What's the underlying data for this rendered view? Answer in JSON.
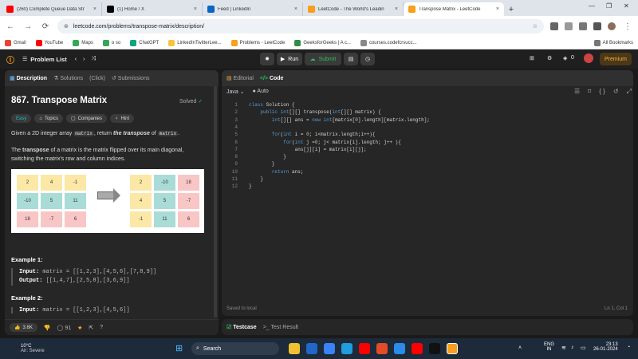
{
  "browser": {
    "tabs": [
      {
        "title": "(260) Complete Queue Data Str",
        "icon": "youtube-icon",
        "color": "#ff0000"
      },
      {
        "title": "(1) Home / X",
        "icon": "x-icon",
        "color": "#000000"
      },
      {
        "title": "Feed | LinkedIn",
        "icon": "linkedin-icon",
        "color": "#0a66c2"
      },
      {
        "title": "LeetCode - The World's Leadin",
        "icon": "leetcode-icon",
        "color": "#f89f1b"
      },
      {
        "title": "Transpose Matrix - LeetCode",
        "icon": "leetcode-icon",
        "color": "#f89f1b",
        "active": true
      }
    ],
    "url": "leetcode.com/problems/transpose-matrix/description/",
    "bookmarks": [
      {
        "label": "Gmail",
        "color": "#ea4335"
      },
      {
        "label": "YouTube",
        "color": "#ff0000"
      },
      {
        "label": "Maps",
        "color": "#34a853"
      },
      {
        "label": "o so",
        "color": "#34a853"
      },
      {
        "label": "ChatGPT",
        "color": "#10a37f"
      },
      {
        "label": "LinkedInTwitterLee...",
        "color": "#f9c43a"
      },
      {
        "label": "Problems - LeetCode",
        "color": "#f89f1b"
      },
      {
        "label": "GeeksforGeeks | A c...",
        "color": "#2f8d46"
      },
      {
        "label": "courses.codefcrsucc...",
        "color": "#888888"
      }
    ],
    "all_bookmarks": "All Bookmarks"
  },
  "header": {
    "problem_list": "Problem List",
    "run": "Run",
    "submit": "Submit",
    "fire_count": "0",
    "premium": "Premium"
  },
  "left": {
    "tabs": [
      "Description",
      "Solutions",
      "(Click)",
      "Submissions"
    ],
    "title": "867. Transpose Matrix",
    "solved": "Solved",
    "tags": [
      "Easy",
      "Topics",
      "Companies",
      "Hint"
    ],
    "desc1_a": "Given a 2D integer array",
    "desc1_code": "matrix",
    "desc1_b": ", return",
    "desc1_c": "the transpose",
    "desc1_d": "of",
    "desc2_a": "The",
    "desc2_b": "transpose",
    "desc2_c": "of a matrix is the matrix flipped over its main diagonal,",
    "desc2_d": "switching the matrix's row and column indices.",
    "matrix_before": [
      [
        "2",
        "4",
        "-1"
      ],
      [
        "-10",
        "5",
        "11"
      ],
      [
        "18",
        "-7",
        "6"
      ]
    ],
    "matrix_after": [
      [
        "2",
        "-10",
        "18"
      ],
      [
        "4",
        "5",
        "-7"
      ],
      [
        "-1",
        "11",
        "6"
      ]
    ],
    "example1_title": "Example 1:",
    "example1_input_label": "Input:",
    "example1_input": "matrix = [[1,2,3],[4,5,6],[7,8,9]]",
    "example1_output_label": "Output:",
    "example1_output": "[[1,4,7],[2,5,8],[3,6,9]]",
    "example2_title": "Example 2:",
    "example2_input_label": "Input:",
    "example2_input": "matrix = [[1,2,3],[4,5,6]]",
    "likes": "3.6K",
    "comments": "91"
  },
  "right": {
    "tabs": [
      "Editorial",
      "Code"
    ],
    "language": "Java",
    "auto": "Auto",
    "code_lines": [
      "class Solution {",
      "    public int[][] transpose(int[][] matrix) {",
      "        int[][] ans = new int[matrix[0].length][matrix.length];",
      "",
      "        for(int i = 0; i<matrix.length;i++){",
      "            for(int j =0; j< matrix[i].length; j++ ){",
      "                ans[j][i] = matrix[i][j];",
      "            }",
      "        }",
      "        return ans;",
      "    }",
      "}"
    ],
    "saved": "Saved to local",
    "cursor": "Ln 1, Col 1",
    "bottom_tabs": [
      "Testcase",
      "Test Result"
    ]
  },
  "taskbar": {
    "temp": "10°C",
    "weather": "Air: Severe",
    "search": "Search",
    "lang": "ENG",
    "region": "IN",
    "time": "23:13",
    "date": "26-01-2024"
  }
}
